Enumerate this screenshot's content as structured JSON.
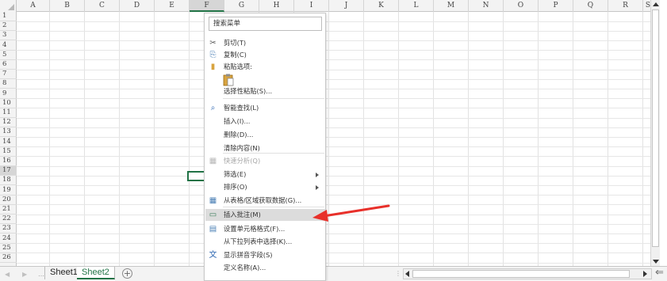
{
  "columns": [
    "A",
    "B",
    "C",
    "D",
    "E",
    "F",
    "G",
    "H",
    "I",
    "J",
    "K",
    "L",
    "M",
    "N",
    "O",
    "P",
    "Q",
    "R",
    "S"
  ],
  "selected_column": "F",
  "rows": [
    "1",
    "2",
    "3",
    "4",
    "5",
    "6",
    "7",
    "8",
    "9",
    "10",
    "11",
    "12",
    "13",
    "14",
    "15",
    "16",
    "17",
    "18",
    "19",
    "20",
    "21",
    "22",
    "23",
    "24",
    "25",
    "26"
  ],
  "selected_row": "17",
  "context_menu": {
    "search_placeholder": "搜索菜单",
    "items": [
      {
        "label": "剪切(T)",
        "icon": "scissors-icon"
      },
      {
        "label": "复制(C)",
        "icon": "copy-icon"
      },
      {
        "label": "粘贴选项:",
        "icon": "paste-icon"
      },
      {
        "label": "选择性粘贴(S)...",
        "icon": ""
      },
      {
        "label": "智能查找(L)",
        "icon": "smart-lookup-icon"
      },
      {
        "label": "插入(I)...",
        "icon": ""
      },
      {
        "label": "删除(D)...",
        "icon": ""
      },
      {
        "label": "清除内容(N)",
        "icon": ""
      },
      {
        "label": "快速分析(Q)",
        "icon": "quick-analysis-icon",
        "disabled": true
      },
      {
        "label": "筛选(E)",
        "icon": "",
        "submenu": true
      },
      {
        "label": "排序(O)",
        "icon": "",
        "submenu": true
      },
      {
        "label": "从表格/区域获取数据(G)...",
        "icon": "table-icon"
      },
      {
        "label": "插入批注(M)",
        "icon": "comment-icon",
        "highlighted": true
      },
      {
        "label": "设置单元格格式(F)...",
        "icon": "format-cells-icon"
      },
      {
        "label": "从下拉列表中选择(K)...",
        "icon": ""
      },
      {
        "label": "显示拼音字段(S)",
        "icon": "phonetic-icon",
        "icon_text": "wén"
      },
      {
        "label": "定义名称(A)...",
        "icon": ""
      }
    ]
  },
  "sheet_tabs": [
    {
      "label": "Sheet1",
      "active": false
    },
    {
      "label": "Sheet2",
      "active": true
    }
  ],
  "add_sheet_label": "+",
  "colors": {
    "accent_green": "#217346",
    "arrow_red": "#e8302a",
    "highlight": "#dcdcdc"
  }
}
